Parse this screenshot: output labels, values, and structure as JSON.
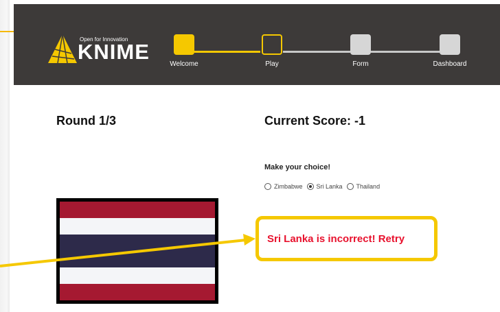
{
  "brand": {
    "tagline": "Open for Innovation",
    "wordmark": "KNIME",
    "accent": "#f5c800"
  },
  "steps": [
    {
      "label": "Welcome",
      "state": "completed"
    },
    {
      "label": "Play",
      "state": "active"
    },
    {
      "label": "Form",
      "state": "pending"
    },
    {
      "label": "Dashboard",
      "state": "pending"
    }
  ],
  "game": {
    "round_label": "Round 1/3",
    "score_label": "Current Score: -1",
    "prompt": "Make your choice!",
    "options": [
      {
        "label": "Zimbabwe",
        "selected": false
      },
      {
        "label": "Sri Lanka",
        "selected": true
      },
      {
        "label": "Thailand",
        "selected": false
      }
    ],
    "feedback": "Sri Lanka is incorrect! Retry",
    "feedback_color": "#e8112d"
  },
  "flag_icon": "thailand-flag"
}
